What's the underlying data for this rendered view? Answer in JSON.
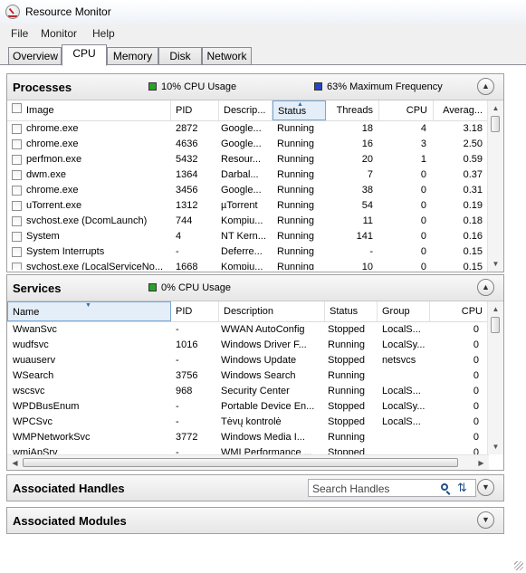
{
  "window": {
    "title": "Resource Monitor"
  },
  "menu": [
    "File",
    "Monitor",
    "Help"
  ],
  "tabs": [
    "Overview",
    "CPU",
    "Memory",
    "Disk",
    "Network"
  ],
  "active_tab": "CPU",
  "processes": {
    "title": "Processes",
    "cpu_usage": "10% CPU Usage",
    "max_frequency": "63% Maximum Frequency",
    "columns": [
      "Image",
      "PID",
      "Descrip...",
      "Status",
      "Threads",
      "CPU",
      "Averag..."
    ],
    "sorted_column": "Status",
    "rows": [
      [
        "chrome.exe",
        "2872",
        "Google...",
        "Running",
        "18",
        "4",
        "3.18"
      ],
      [
        "chrome.exe",
        "4636",
        "Google...",
        "Running",
        "16",
        "3",
        "2.50"
      ],
      [
        "perfmon.exe",
        "5432",
        "Resour...",
        "Running",
        "20",
        "1",
        "0.59"
      ],
      [
        "dwm.exe",
        "1364",
        "Darbal...",
        "Running",
        "7",
        "0",
        "0.37"
      ],
      [
        "chrome.exe",
        "3456",
        "Google...",
        "Running",
        "38",
        "0",
        "0.31"
      ],
      [
        "uTorrent.exe",
        "1312",
        "µTorrent",
        "Running",
        "54",
        "0",
        "0.19"
      ],
      [
        "svchost.exe (DcomLaunch)",
        "744",
        "Kompiu...",
        "Running",
        "11",
        "0",
        "0.18"
      ],
      [
        "System",
        "4",
        "NT Kern...",
        "Running",
        "141",
        "0",
        "0.16"
      ],
      [
        "System Interrupts",
        "-",
        "Deferre...",
        "Running",
        "-",
        "0",
        "0.15"
      ],
      [
        "svchost.exe (LocalServiceNo...",
        "1668",
        "Kompiu...",
        "Running",
        "10",
        "0",
        "0.15"
      ]
    ]
  },
  "services": {
    "title": "Services",
    "cpu_usage": "0% CPU Usage",
    "columns": [
      "Name",
      "PID",
      "Description",
      "Status",
      "Group",
      "CPU"
    ],
    "sorted_column": "Name",
    "rows": [
      [
        "WwanSvc",
        "-",
        "WWAN AutoConfig",
        "Stopped",
        "LocalS...",
        "0"
      ],
      [
        "wudfsvc",
        "1016",
        "Windows Driver F...",
        "Running",
        "LocalSy...",
        "0"
      ],
      [
        "wuauserv",
        "-",
        "Windows Update",
        "Stopped",
        "netsvcs",
        "0"
      ],
      [
        "WSearch",
        "3756",
        "Windows Search",
        "Running",
        "",
        "0"
      ],
      [
        "wscsvc",
        "968",
        "Security Center",
        "Running",
        "LocalS...",
        "0"
      ],
      [
        "WPDBusEnum",
        "-",
        "Portable Device En...",
        "Stopped",
        "LocalSy...",
        "0"
      ],
      [
        "WPCSvc",
        "-",
        "Tėvų kontrolė",
        "Stopped",
        "LocalS...",
        "0"
      ],
      [
        "WMPNetworkSvc",
        "3772",
        "Windows Media I...",
        "Running",
        "",
        "0"
      ],
      [
        "wmiApSrv",
        "-",
        "WMI Performance ...",
        "Stopped",
        "",
        "0"
      ]
    ]
  },
  "handles": {
    "title": "Associated Handles",
    "search_placeholder": "Search Handles"
  },
  "modules": {
    "title": "Associated Modules"
  },
  "colors": {
    "cpu_usage": "#2aa12a",
    "max_frequency": "#2546c4",
    "sorted_header": "#e3eef9"
  },
  "icons": [
    "resource-monitor-icon",
    "collapse-icon",
    "expand-icon",
    "search-icon",
    "refresh-icon",
    "checkbox-icon",
    "sort-indicator-icon"
  ]
}
